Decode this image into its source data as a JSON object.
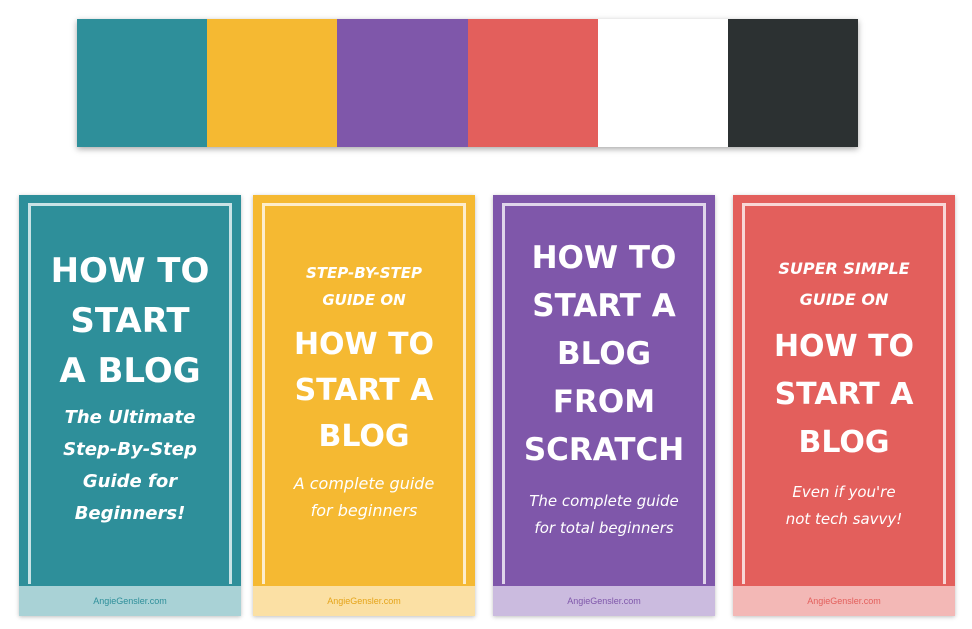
{
  "palette": {
    "colors": [
      "#2E8F9A",
      "#F5B932",
      "#7F57AA",
      "#E35F5C",
      "#FFFFFF",
      "#2C3132"
    ]
  },
  "cards": [
    {
      "bg": "#2E8F9A",
      "footer_bg": "#A9D2D6",
      "footer_color": "#2E8F9A",
      "title_lines": [
        "HOW TO",
        "START",
        "A BLOG"
      ],
      "subtitle_lines": [
        "The Ultimate",
        "Step-By-Step",
        "Guide for",
        "Beginners!"
      ],
      "footer": "AngieGensler.com"
    },
    {
      "bg": "#F5B932",
      "footer_bg": "#FBE0A4",
      "footer_color": "#E5A41A",
      "pretitle_lines": [
        "STEP-BY-STEP",
        "GUIDE ON"
      ],
      "title_lines": [
        "HOW TO",
        "START A",
        "BLOG"
      ],
      "subtitle_lines": [
        "A complete guide",
        "for beginners"
      ],
      "footer": "AngieGensler.com"
    },
    {
      "bg": "#7F57AA",
      "footer_bg": "#CBBBDF",
      "footer_color": "#7F57AA",
      "title_lines": [
        "HOW TO",
        "START A",
        "BLOG",
        "FROM",
        "SCRATCH"
      ],
      "subtitle_lines": [
        "The complete guide",
        "for total beginners"
      ],
      "footer": "AngieGensler.com"
    },
    {
      "bg": "#E35F5C",
      "footer_bg": "#F3B8B6",
      "footer_color": "#E35F5C",
      "pretitle_lines": [
        "SUPER SIMPLE",
        "GUIDE ON"
      ],
      "title_lines": [
        "HOW TO",
        "START A",
        "BLOG"
      ],
      "subtitle_lines": [
        "Even if you're",
        "not tech savvy!"
      ],
      "footer": "AngieGensler.com"
    }
  ]
}
